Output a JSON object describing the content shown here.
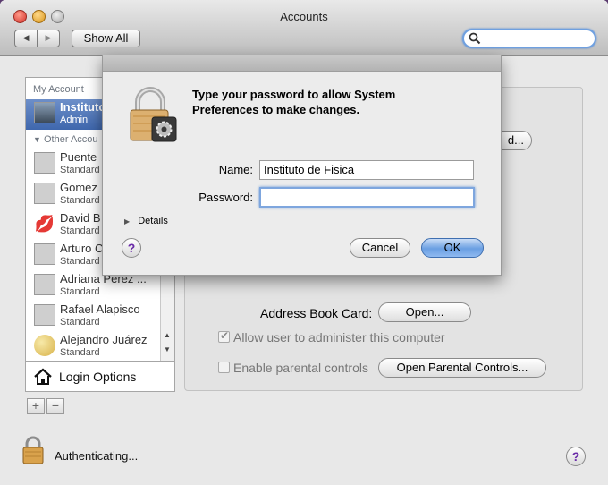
{
  "window": {
    "title": "Accounts"
  },
  "toolbar": {
    "show_all_label": "Show All",
    "back_icon": "◀",
    "forward_icon": "▶"
  },
  "sidebar": {
    "my_account_header": "My Account",
    "other_accounts_header": "Other Accou",
    "current_user": {
      "name": "Instituto",
      "role": "Admin"
    },
    "users": [
      {
        "name": "Puente",
        "role": "Standard"
      },
      {
        "name": "Gomez",
        "role": "Standard"
      },
      {
        "name": "David B",
        "role": "Standard"
      },
      {
        "name": "Arturo C",
        "role": "Standard"
      },
      {
        "name": "Adriana Perez ...",
        "role": "Standard"
      },
      {
        "name": "Rafael Alapisco",
        "role": "Standard"
      },
      {
        "name": "Alejandro Juárez",
        "role": "Standard"
      }
    ],
    "login_options_label": "Login Options",
    "add_label": "+",
    "remove_label": "−"
  },
  "panel": {
    "partial_button_label": "d...",
    "address_book_label": "Address Book Card:",
    "open_button_label": "Open...",
    "allow_admin_label": "Allow user to administer this computer",
    "parental_label": "Enable parental controls",
    "open_parental_label": "Open Parental Controls..."
  },
  "dialog": {
    "message": "Type your password to allow System Preferences to make changes.",
    "name_label": "Name:",
    "name_value": "Instituto de Fisica",
    "password_label": "Password:",
    "password_value": "",
    "details_label": "Details",
    "cancel_label": "Cancel",
    "ok_label": "OK",
    "help_label": "?"
  },
  "footer": {
    "status_text": "Authenticating...",
    "help_label": "?"
  },
  "colors": {
    "accent": "#4a86d8",
    "close": "#e0443e",
    "minimize": "#dea123",
    "zoom": "#9a9a9a"
  }
}
